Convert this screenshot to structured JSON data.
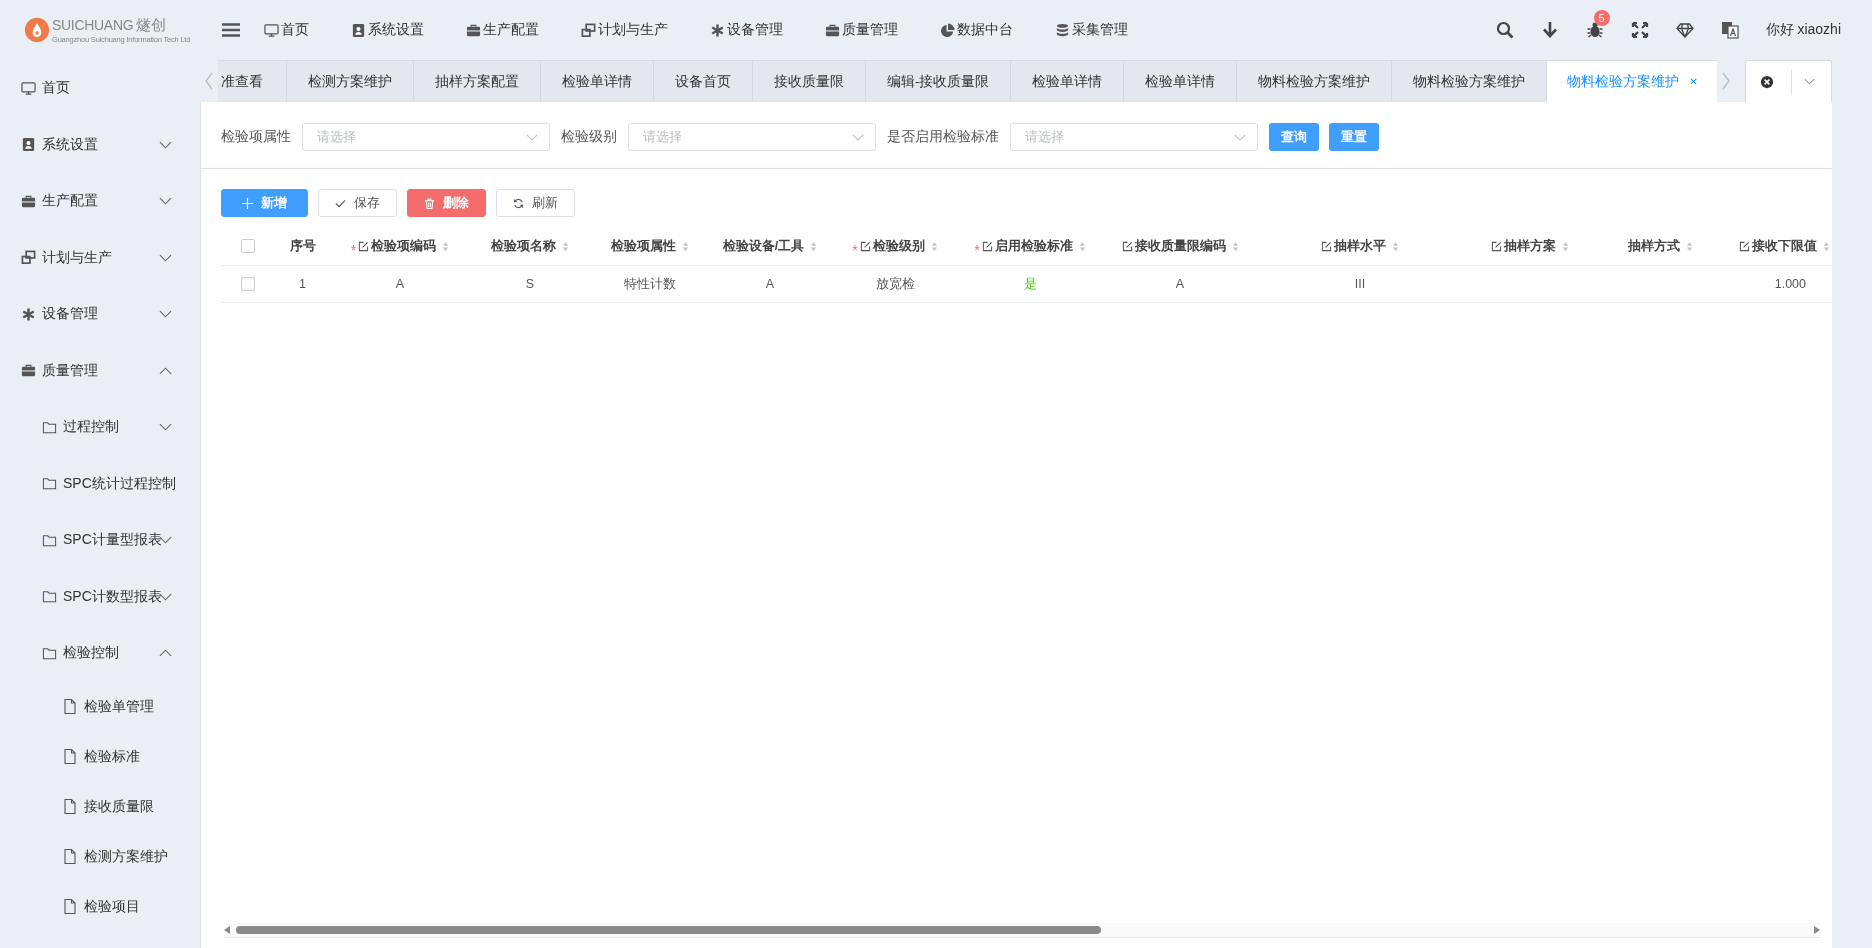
{
  "logo": {
    "brand": "SUICHUANG",
    "brand_cn": "燧创",
    "subtitle": "Guangzhou Suichuang Information Tech Ltd"
  },
  "top_menu": [
    {
      "label": "首页"
    },
    {
      "label": "系统设置"
    },
    {
      "label": "生产配置"
    },
    {
      "label": "计划与生产"
    },
    {
      "label": "设备管理"
    },
    {
      "label": "质量管理"
    },
    {
      "label": "数据中台"
    },
    {
      "label": "采集管理"
    }
  ],
  "notifications": {
    "badge": "5"
  },
  "user": {
    "greeting": "你好 xiaozhi"
  },
  "sidebar": {
    "items": [
      {
        "label": "首页",
        "has_children": false
      },
      {
        "label": "系统设置",
        "expanded": false,
        "has_children": true
      },
      {
        "label": "生产配置",
        "expanded": false,
        "has_children": true
      },
      {
        "label": "计划与生产",
        "expanded": false,
        "has_children": true
      },
      {
        "label": "设备管理",
        "expanded": false,
        "has_children": true
      },
      {
        "label": "质量管理",
        "expanded": true,
        "has_children": true,
        "children": [
          {
            "label": "过程控制",
            "expanded": false,
            "has_children": true
          },
          {
            "label": "SPC统计过程控制",
            "has_children": false
          },
          {
            "label": "SPC计量型报表",
            "expanded": false,
            "has_children": true
          },
          {
            "label": "SPC计数型报表",
            "expanded": false,
            "has_children": true
          },
          {
            "label": "检验控制",
            "expanded": true,
            "has_children": true,
            "children": [
              {
                "label": "检验单管理",
                "has_children": false
              },
              {
                "label": "检验标准",
                "has_children": false
              },
              {
                "label": "接收质量限",
                "has_children": false
              },
              {
                "label": "检测方案维护",
                "has_children": false
              },
              {
                "label": "检验项目",
                "has_children": false
              }
            ]
          }
        ]
      }
    ]
  },
  "tabs": [
    {
      "label": "准查看",
      "selected": false
    },
    {
      "label": "检测方案维护",
      "selected": false
    },
    {
      "label": "抽样方案配置",
      "selected": false
    },
    {
      "label": "检验单详情",
      "selected": false
    },
    {
      "label": "设备首页",
      "selected": false
    },
    {
      "label": "接收质量限",
      "selected": false
    },
    {
      "label": "编辑-接收质量限",
      "selected": false
    },
    {
      "label": "检验单详情",
      "selected": false
    },
    {
      "label": "检验单详情",
      "selected": false
    },
    {
      "label": "物料检验方案维护",
      "selected": false
    },
    {
      "label": "物料检验方案维护",
      "selected": false
    },
    {
      "label": "物料检验方案维护",
      "selected": true
    }
  ],
  "filters": [
    {
      "label": "检验项属性",
      "placeholder": "请选择"
    },
    {
      "label": "检验级别",
      "placeholder": "请选择"
    },
    {
      "label": "是否启用检验标准",
      "placeholder": "请选择"
    }
  ],
  "filter_buttons": [
    "查询",
    "重置"
  ],
  "toolbar": [
    {
      "label": "新增",
      "kind": "primary"
    },
    {
      "label": "保存",
      "kind": "plain"
    },
    {
      "label": "删除",
      "kind": "danger"
    },
    {
      "label": "刷新",
      "kind": "plain"
    }
  ],
  "table": {
    "all_checked": false,
    "columns": [
      {
        "label": "序号",
        "editable": false,
        "sortable": false
      },
      {
        "label": "检验项编码",
        "required_mark": "*",
        "editable": true,
        "sortable": true
      },
      {
        "label": "检验项名称",
        "editable": false,
        "sortable": true
      },
      {
        "label": "检验项属性",
        "editable": false,
        "sortable": true
      },
      {
        "label": "检验设备/工具",
        "editable": false,
        "sortable": true
      },
      {
        "label": "检验级别",
        "required_mark": "*",
        "editable": true,
        "sortable": true
      },
      {
        "label": "启用检验标准",
        "required_mark": "*",
        "editable": true,
        "sortable": true
      },
      {
        "label": "接收质量限编码",
        "editable": true,
        "sortable": true
      },
      {
        "label": "抽样水平",
        "editable": true,
        "sortable": true
      },
      {
        "label": "抽样方案",
        "editable": true,
        "sortable": true
      },
      {
        "label": "抽样方式",
        "editable": false,
        "sortable": true
      },
      {
        "label": "接收下限值",
        "editable": true,
        "sortable": true
      }
    ],
    "rows": [
      {
        "checked": false,
        "cells": [
          {
            "text": "1"
          },
          {
            "text": "A"
          },
          {
            "text": "S"
          },
          {
            "text": "特性计数"
          },
          {
            "text": "A"
          },
          {
            "text": "放宽检"
          },
          {
            "text": "是",
            "kind": "yes"
          },
          {
            "text": "A"
          },
          {
            "text": "III"
          },
          null,
          null,
          {
            "text": "1.000"
          }
        ]
      }
    ]
  }
}
